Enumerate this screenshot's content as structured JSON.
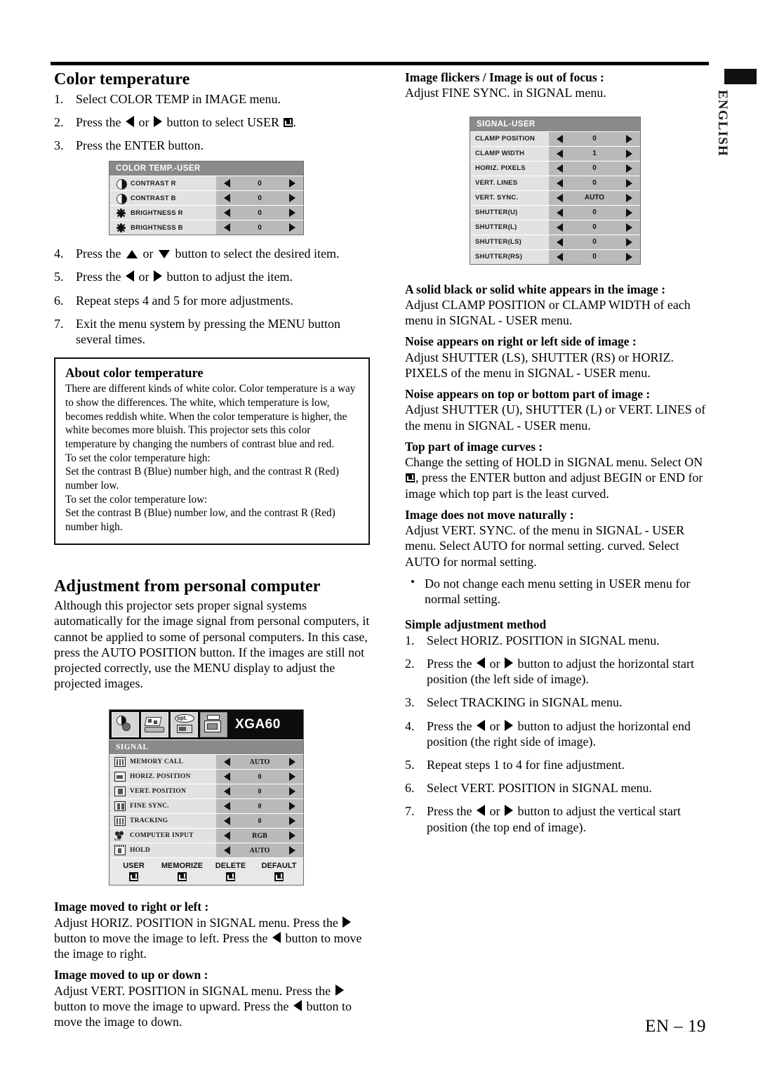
{
  "page": {
    "language_tab": "ENGLISH",
    "page_number": "EN – 19"
  },
  "left_column": {
    "section_title": "Color temperature",
    "steps_1_3": [
      {
        "num": "1.",
        "text_before": "Select COLOR TEMP in IMAGE menu.",
        "icons": []
      },
      {
        "num": "2.",
        "text_before": "Press the",
        "text_mid": "or",
        "text_after": "button to select USER",
        "text_end": "."
      },
      {
        "num": "3.",
        "text_before": "Press the ENTER button.",
        "icons": []
      }
    ],
    "color_temp_menu": {
      "title": "COLOR TEMP.-USER",
      "rows": [
        {
          "icon": "contrast-icon",
          "label": "CONTRAST R",
          "value": "0"
        },
        {
          "icon": "contrast-icon",
          "label": "CONTRAST B",
          "value": "0"
        },
        {
          "icon": "brightness-icon",
          "label": "BRIGHTNESS R",
          "value": "0"
        },
        {
          "icon": "brightness-icon",
          "label": "BRIGHTNESS B",
          "value": "0"
        }
      ]
    },
    "steps_4_7": [
      {
        "num": "4.",
        "a": "Press the",
        "b": "or",
        "c": "button to select the desired item."
      },
      {
        "num": "5.",
        "a": "Press the",
        "b": "or",
        "c": "button to adjust the item."
      },
      {
        "num": "6.",
        "a": "Repeat steps 4 and 5 for more adjustments."
      },
      {
        "num": "7.",
        "a": "Exit the menu system by pressing the MENU button several times."
      }
    ],
    "note_box": {
      "title": "About color temperature",
      "paragraphs": [
        "There are different kinds of white color. Color temperature is a way to show the differences. The white, which temperature is low, becomes reddish white. When the color temperature is higher, the white becomes more bluish. This projector sets this color temperature by changing the numbers of contrast blue and red.",
        "To set the color temperature high:",
        "Set the contrast B (Blue) number high, and the contrast R (Red) number low.",
        "To set the color temperature low:",
        "Set the contrast B (Blue) number low, and the contrast R (Red) number high."
      ]
    },
    "section_title_2": "Adjustment from personal computer",
    "intro_paragraph": "Although this projector sets proper signal systems automatically for the image signal from personal computers, it cannot be applied to some of personal computers.  In this case, press the AUTO POSITION button.  If the images are still not projected correctly, use the MENU display to adjust the projected images.",
    "signal_menu": {
      "mode_label": "XGA60",
      "tabs": [
        {
          "name": "image-tab"
        },
        {
          "name": "installation-tab"
        },
        {
          "name": "option-tab",
          "label": "opt."
        },
        {
          "name": "signal-tab",
          "active": true
        }
      ],
      "title": "SIGNAL",
      "rows": [
        {
          "icon": "memory-call-icon",
          "label": "MEMORY CALL",
          "value": "AUTO"
        },
        {
          "icon": "horiz-position-icon",
          "label": "HORIZ. POSITION",
          "value": "0"
        },
        {
          "icon": "vert-position-icon",
          "label": "VERT. POSITION",
          "value": "0"
        },
        {
          "icon": "fine-sync-icon",
          "label": "FINE SYNC.",
          "value": "0"
        },
        {
          "icon": "tracking-icon",
          "label": "TRACKING",
          "value": "0"
        },
        {
          "icon": "computer-input-icon",
          "label": "COMPUTER INPUT",
          "value": "RGB"
        },
        {
          "icon": "hold-icon",
          "label": "HOLD",
          "value": "AUTO"
        }
      ],
      "footer_buttons": [
        "USER",
        "MEMORIZE",
        "DELETE",
        "DEFAULT"
      ]
    },
    "trouble_1": {
      "heading": "Image moved to right or left :",
      "a": "Adjust HORIZ. POSITION in SIGNAL menu.  Press the",
      "b": "button to move the image to left.  Press the",
      "c": "button to move the image to right."
    },
    "trouble_2": {
      "heading": "Image moved to up or down :",
      "a": "Adjust VERT. POSITION in SIGNAL menu.  Press the",
      "b": "button to move the image to upward.  Press the",
      "c": "button to move the image to down."
    }
  },
  "right_column": {
    "trouble_flicker": {
      "heading": "Image flickers / Image is out of focus :",
      "body": "Adjust FINE SYNC. in SIGNAL menu."
    },
    "signal_user_menu": {
      "title": "SIGNAL-USER",
      "rows": [
        {
          "label": "CLAMP POSITION",
          "value": "0"
        },
        {
          "label": "CLAMP WIDTH",
          "value": "1"
        },
        {
          "label": "HORIZ. PIXELS",
          "value": "0"
        },
        {
          "label": "VERT. LINES",
          "value": "0"
        },
        {
          "label": "VERT. SYNC.",
          "value": "AUTO"
        },
        {
          "label": "SHUTTER(U)",
          "value": "0"
        },
        {
          "label": "SHUTTER(L)",
          "value": "0"
        },
        {
          "label": "SHUTTER(LS)",
          "value": "0"
        },
        {
          "label": "SHUTTER(RS)",
          "value": "0"
        }
      ]
    },
    "trouble_solid": {
      "heading": "A solid black or solid white appears in the image :",
      "body": "Adjust CLAMP POSITION or CLAMP WIDTH of each menu in SIGNAL - USER menu."
    },
    "trouble_noise_side": {
      "heading": "Noise appears on right or left side of image :",
      "body": "Adjust SHUTTER (LS), SHUTTER (RS) or HORIZ. PIXELS  of the menu in SIGNAL - USER menu."
    },
    "trouble_noise_topbottom": {
      "heading": "Noise appears on top or bottom part of image :",
      "body": "Adjust SHUTTER (U), SHUTTER (L) or VERT. LINES of the menu in SIGNAL - USER menu."
    },
    "trouble_curves": {
      "heading": "Top part of image curves :",
      "a": "Change the setting of HOLD in SIGNAL menu. Select ON",
      "b": ", press the ENTER button and adjust BEGIN or END for image which top part is the least curved."
    },
    "trouble_natural": {
      "heading": "Image does not move naturally :",
      "body": "Adjust VERT. SYNC. of the menu in SIGNAL - USER menu.  Select AUTO for normal setting. curved.  Select AUTO for normal setting."
    },
    "bullet_note": "Do not change each menu setting in USER menu for normal setting.",
    "simple_method": {
      "heading": "Simple adjustment method",
      "steps": [
        {
          "num": "1.",
          "a": "Select HORIZ. POSITION in SIGNAL menu."
        },
        {
          "num": "2.",
          "a": "Press the",
          "b": "or",
          "c": "button to adjust the horizontal start position (the left side of image)."
        },
        {
          "num": "3.",
          "a": "Select TRACKING in SIGNAL menu."
        },
        {
          "num": "4.",
          "a": "Press the",
          "b": "or",
          "c": "button to adjust the horizontal end position (the right side of image)."
        },
        {
          "num": "5.",
          "a": "Repeat steps 1 to 4 for fine adjustment."
        },
        {
          "num": "6.",
          "a": "Select VERT. POSITION in SIGNAL menu."
        },
        {
          "num": "7.",
          "a": "Press the",
          "b": "or",
          "c": "button to adjust the vertical start position (the top end of image)."
        }
      ]
    }
  }
}
